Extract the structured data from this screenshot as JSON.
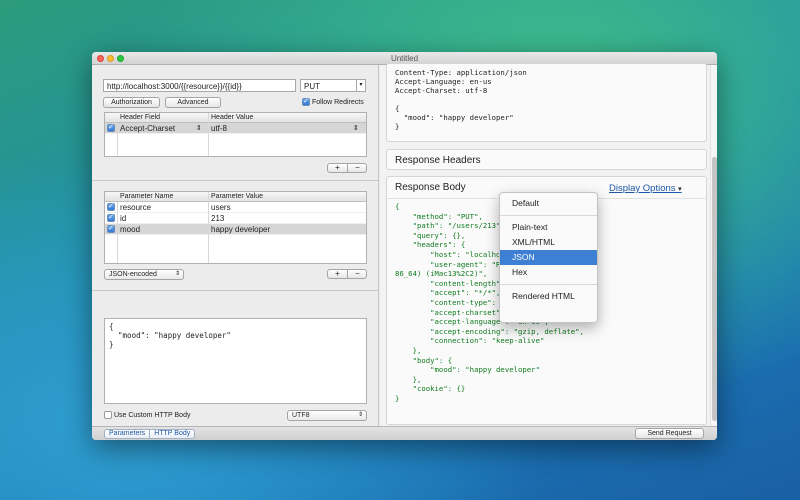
{
  "window": {
    "title": "Untitled"
  },
  "request": {
    "url": "http://localhost:3000/{{resource}}/{{id}}",
    "method": "PUT",
    "authorization_label": "Authorization",
    "advanced_label": "Advanced",
    "follow_redirects_label": "Follow Redirects"
  },
  "headers_table": {
    "col_field": "Header Field",
    "col_value": "Header Value",
    "rows": [
      {
        "field": "Accept-Charset",
        "value": "utf-8"
      }
    ]
  },
  "params_table": {
    "col_name": "Parameter Name",
    "col_value": "Parameter Value",
    "rows": [
      {
        "name": "resource",
        "value": "users"
      },
      {
        "name": "id",
        "value": "213"
      },
      {
        "name": "mood",
        "value": "happy developer"
      }
    ],
    "encoding": "JSON-encoded"
  },
  "plus_minus": {
    "plus": "+",
    "minus": "−"
  },
  "body_editor": {
    "text": "{\n  \"mood\": \"happy developer\"\n}",
    "custom_body_label": "Use Custom HTTP Body",
    "charset": "UTF8"
  },
  "bottom": {
    "tab_parameters": "Parameters",
    "tab_http_body": "HTTP Body",
    "send_label": "Send Request"
  },
  "request_preview": {
    "text": "Content-Type: application/json\nAccept-Language: en-us\nAccept-Charset: utf-8\n\n{\n  \"mood\": \"happy developer\"\n}"
  },
  "response": {
    "headers_title": "Response Headers",
    "body_title": "Response Body",
    "display_options": "Display Options",
    "body_text": "{\n    \"method\": \"PUT\",\n    \"path\": \"/users/213\",\n    \"query\": {},\n    \"headers\": {\n        \"host\": \"localhost:3000\",\n        \"user-agent\": \"Rested/2009 CFNetwork/\n86_64) (iMac13%2C2)\",\n        \"content-length\": \"31\",\n        \"accept\": \"*/*\",\n        \"content-type\": \"application/json\",\n        \"accept-charset\": \"utf-8\",\n        \"accept-language\": \"en-us\",\n        \"accept-encoding\": \"gzip, deflate\",\n        \"connection\": \"keep-alive\"\n    },\n    \"body\": {\n        \"mood\": \"happy developer\"\n    },\n    \"cookie\": {}\n}"
  },
  "display_menu": {
    "items": [
      "Default",
      "Plain-text",
      "XML/HTML",
      "JSON",
      "Hex",
      "Rendered HTML"
    ],
    "selected": "JSON"
  }
}
